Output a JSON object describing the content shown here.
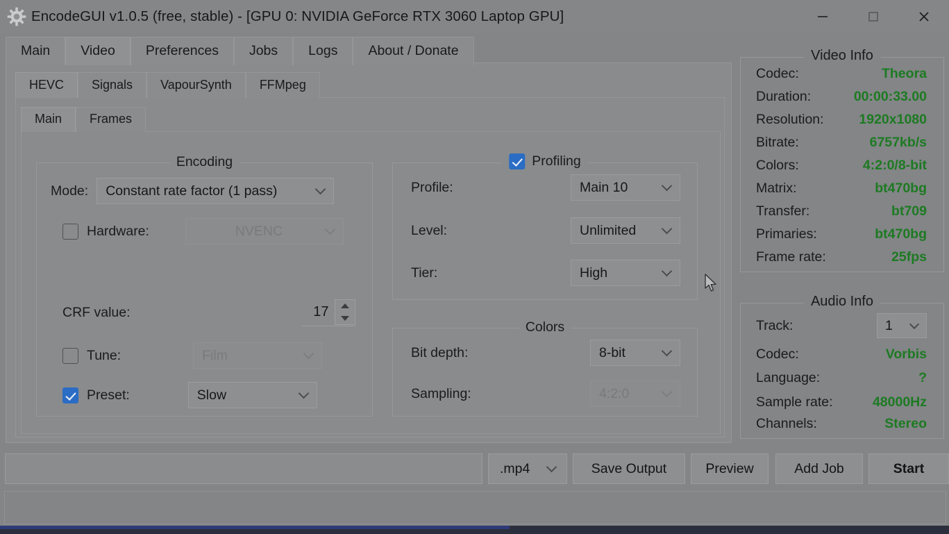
{
  "window": {
    "icon": "gear-icon",
    "title": "EncodeGUI v1.0.5 (free, stable) - [GPU 0: NVIDIA GeForce RTX 3060 Laptop GPU]",
    "controls": {
      "minimize": "minimize-icon",
      "maximize": "maximize-icon",
      "close": "close-icon"
    }
  },
  "tabs_level1": [
    {
      "label": "Main",
      "active": false
    },
    {
      "label": "Video",
      "active": true
    },
    {
      "label": "Preferences",
      "active": false
    },
    {
      "label": "Jobs",
      "active": false
    },
    {
      "label": "Logs",
      "active": false
    },
    {
      "label": "About / Donate",
      "active": false
    }
  ],
  "tabs_level2": [
    {
      "label": "HEVC",
      "active": true
    },
    {
      "label": "Signals",
      "active": false
    },
    {
      "label": "VapourSynth",
      "active": false
    },
    {
      "label": "FFMpeg",
      "active": false
    }
  ],
  "tabs_level3": [
    {
      "label": "Main",
      "active": true
    },
    {
      "label": "Frames",
      "active": false
    }
  ],
  "encoding": {
    "title": "Encoding",
    "mode_label": "Mode:",
    "mode_value": "Constant rate factor (1 pass)",
    "hardware_label": "Hardware:",
    "hardware_checked": false,
    "hardware_value": "NVENC",
    "crf_label": "CRF value:",
    "crf_value": "17",
    "tune_label": "Tune:",
    "tune_checked": false,
    "tune_value": "Film",
    "preset_label": "Preset:",
    "preset_checked": true,
    "preset_value": "Slow"
  },
  "profiling": {
    "title": "Profiling",
    "checked": true,
    "profile_label": "Profile:",
    "profile_value": "Main 10",
    "level_label": "Level:",
    "level_value": "Unlimited",
    "tier_label": "Tier:",
    "tier_value": "High"
  },
  "colors": {
    "title": "Colors",
    "bitdepth_label": "Bit depth:",
    "bitdepth_value": "8-bit",
    "sampling_label": "Sampling:",
    "sampling_value": "4:2:0"
  },
  "video_info": {
    "title": "Video Info",
    "rows": [
      {
        "key": "Codec:",
        "value": "Theora"
      },
      {
        "key": "Duration:",
        "value": "00:00:33.00"
      },
      {
        "key": "Resolution:",
        "value": "1920x1080"
      },
      {
        "key": "Bitrate:",
        "value": "6757kb/s"
      },
      {
        "key": "Colors:",
        "value": "4:2:0/8-bit"
      },
      {
        "key": "Matrix:",
        "value": "bt470bg"
      },
      {
        "key": "Transfer:",
        "value": "bt709"
      },
      {
        "key": "Primaries:",
        "value": "bt470bg"
      },
      {
        "key": "Frame rate:",
        "value": "25fps"
      }
    ]
  },
  "audio_info": {
    "title": "Audio Info",
    "track_label": "Track:",
    "track_value": "1",
    "rows": [
      {
        "key": "Codec:",
        "value": "Vorbis"
      },
      {
        "key": "Language:",
        "value": "?"
      },
      {
        "key": "Sample rate:",
        "value": "48000Hz"
      },
      {
        "key": "Channels:",
        "value": "Stereo"
      }
    ]
  },
  "bottom": {
    "output_path": "",
    "output_placeholder": "",
    "extension_value": ".mp4",
    "save_output": "Save Output",
    "preview": "Preview",
    "add_job": "Add Job",
    "start": "Start"
  },
  "theme": {
    "accent_blue": "#2b6cc4",
    "info_green": "#1d7a22",
    "window_bg": "#838587",
    "panel_bg": "#898b8d"
  }
}
